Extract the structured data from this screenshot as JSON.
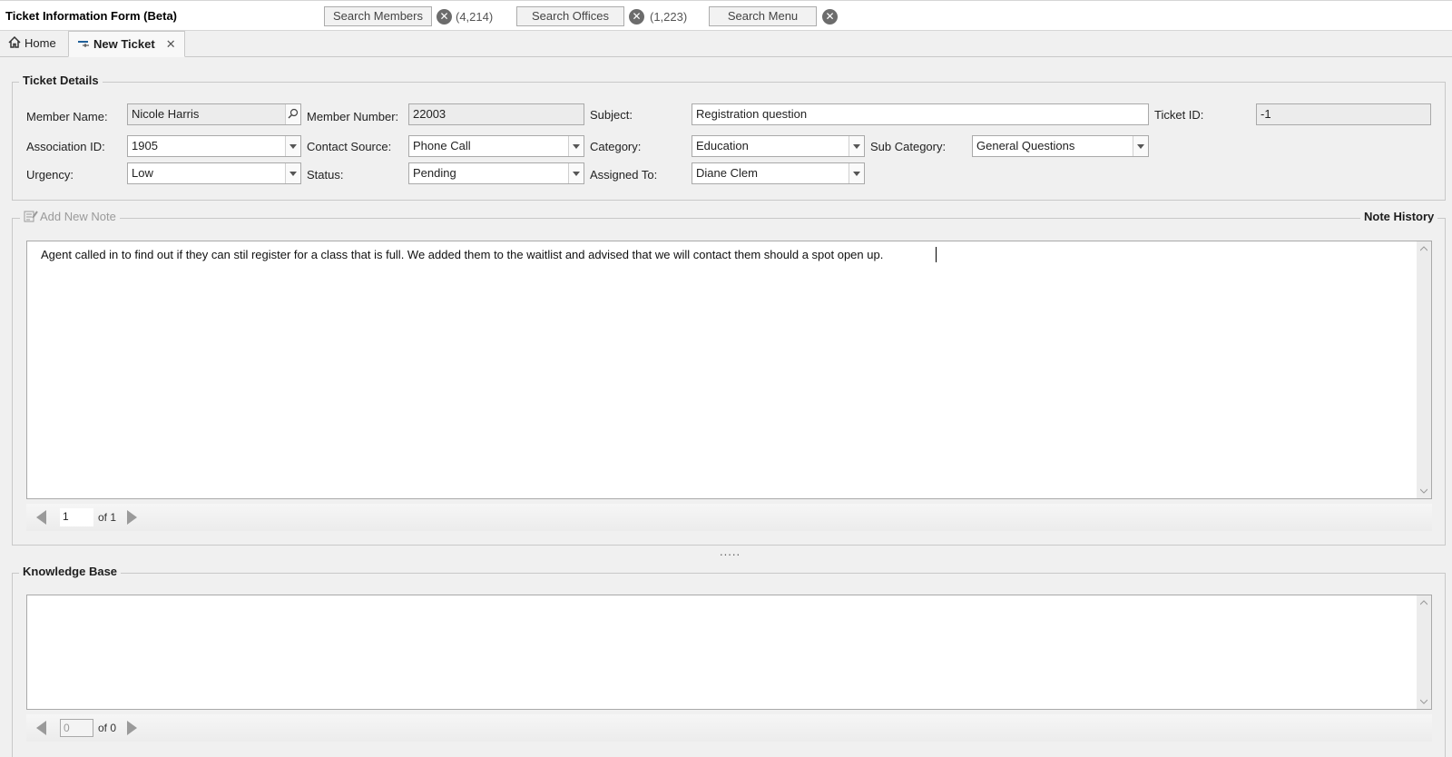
{
  "app": {
    "title": "Ticket Information Form (Beta)"
  },
  "search": {
    "members": {
      "label": "Search Members",
      "count": "(4,214)"
    },
    "offices": {
      "label": "Search Offices",
      "count": "(1,223)"
    },
    "menu": {
      "label": "Search Menu"
    },
    "clear_glyph": "✕"
  },
  "tabs": [
    {
      "label": "Home",
      "icon": "home-icon"
    },
    {
      "label": "New Ticket",
      "icon": "new-ticket-icon",
      "close": "✕"
    }
  ],
  "ticket_details": {
    "legend": "Ticket Details",
    "member_name": {
      "label": "Member Name:",
      "value": "Nicole Harris"
    },
    "member_number": {
      "label": "Member Number:",
      "value": "22003"
    },
    "subject": {
      "label": "Subject:",
      "value": "Registration question"
    },
    "ticket_id": {
      "label": "Ticket ID:",
      "value": "-1"
    },
    "association_id": {
      "label": "Association ID:",
      "value": "1905"
    },
    "contact_source": {
      "label": "Contact Source:",
      "value": "Phone Call"
    },
    "category": {
      "label": "Category:",
      "value": "Education"
    },
    "sub_category": {
      "label": "Sub Category:",
      "value": "General Questions"
    },
    "urgency": {
      "label": "Urgency:",
      "value": "Low"
    },
    "status": {
      "label": "Status:",
      "value": "Pending"
    },
    "assigned_to": {
      "label": "Assigned To:",
      "value": "Diane Clem"
    }
  },
  "notes": {
    "add_label": "Add New Note",
    "history_label": "Note History",
    "text": "Agent called in to find out if they can stil register for a class that is full. We added them to the waitlist and advised that we will contact them should a spot open up.",
    "pager": {
      "current": "1",
      "total": "of 1"
    }
  },
  "splitter": ".....",
  "knowledge_base": {
    "legend": "Knowledge Base",
    "pager": {
      "current": "0",
      "total": "of 0"
    }
  },
  "colors": {
    "accent": "#1f5f99",
    "border": "#a9a9a9",
    "background": "#f0f0f0"
  }
}
